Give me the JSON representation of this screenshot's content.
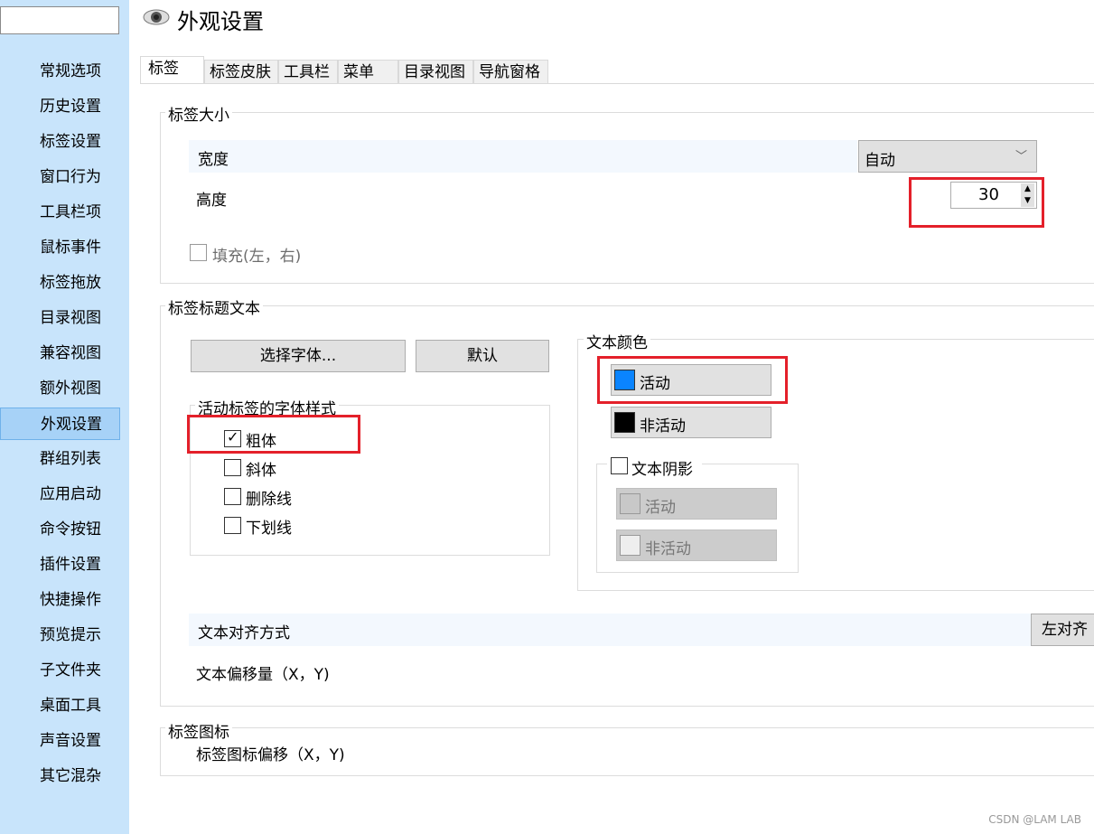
{
  "sidebar": {
    "search_value": "",
    "items": [
      "常规选项",
      "历史设置",
      "标签设置",
      "窗口行为",
      "工具栏项",
      "鼠标事件",
      "标签拖放",
      "目录视图",
      "兼容视图",
      "额外视图",
      "外观设置",
      "群组列表",
      "应用启动",
      "命令按钮",
      "插件设置",
      "快捷操作",
      "预览提示",
      "子文件夹",
      "桌面工具",
      "声音设置",
      "其它混杂"
    ],
    "selected": "外观设置"
  },
  "header": {
    "title": "外观设置",
    "icon": "eye-icon"
  },
  "tabs": [
    "标签",
    "标签皮肤",
    "工具栏",
    "菜单",
    "目录视图",
    "导航窗格"
  ],
  "size_group": {
    "title": "标签大小",
    "width_label": "宽度",
    "width_value": "自动",
    "height_label": "高度",
    "height_value": "30",
    "fill_label": "填充(左，右)",
    "fill_checked": false
  },
  "title_group": {
    "title": "标签标题文本",
    "choose_font": "选择字体...",
    "default": "默认",
    "style_title": "活动标签的字体样式",
    "styles": [
      {
        "label": "粗体",
        "checked": true
      },
      {
        "label": "斜体",
        "checked": false
      },
      {
        "label": "删除线",
        "checked": false
      },
      {
        "label": "下划线",
        "checked": false
      }
    ],
    "color_title": "文本颜色",
    "active": "活动",
    "inactive": "非活动",
    "active_color": "#0a84ff",
    "inactive_color": "#000000",
    "shadow_label": "文本阴影",
    "shadow_active": "活动",
    "shadow_inactive": "非活动",
    "align_label": "文本对齐方式",
    "align_value": "左对齐",
    "offset_label": "文本偏移量（X，Y)"
  },
  "icon_group": {
    "title": "标签图标",
    "offset_label": "标签图标偏移（X，Y)"
  },
  "watermark": "CSDN @LAM LAB"
}
